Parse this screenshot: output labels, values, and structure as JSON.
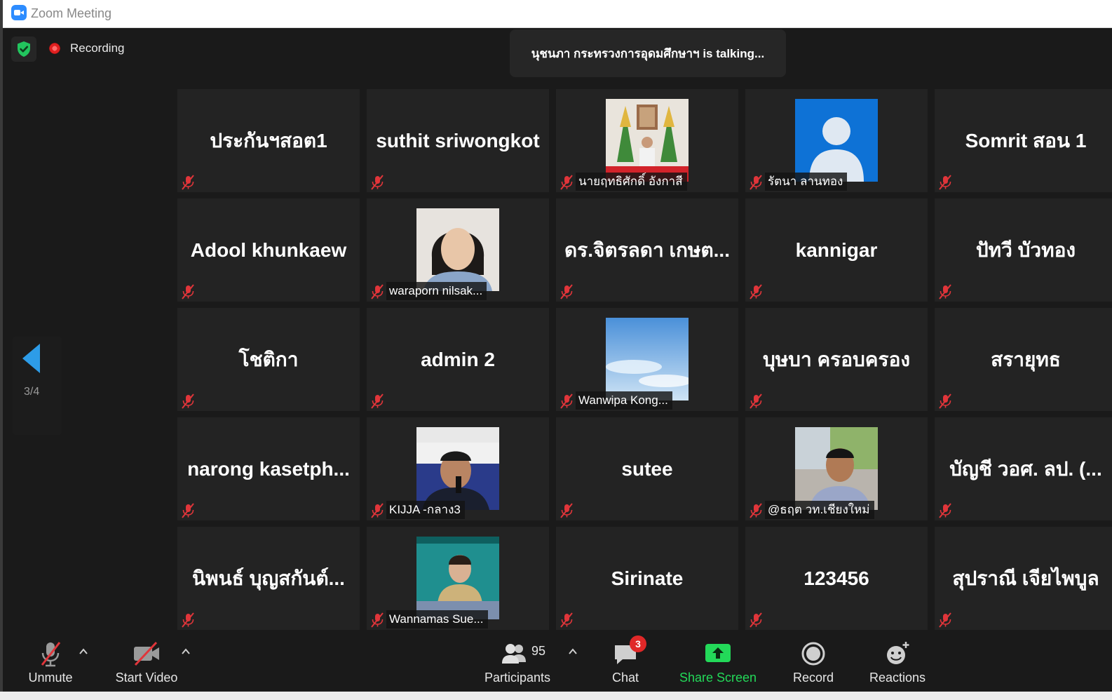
{
  "window": {
    "title": "Zoom Meeting"
  },
  "status": {
    "recording_label": "Recording"
  },
  "talking_banner": "นุชนภา กระทรวงการอุดมศึกษาฯ is talking...",
  "pager": {
    "current": "3/4"
  },
  "participants": [
    {
      "name": "ประกันฯสอต1",
      "video": false,
      "muted": true
    },
    {
      "name": "suthit sriwongkot",
      "video": false,
      "muted": true
    },
    {
      "name": "นายฤทธิศักดิ์ อังกาสี",
      "video": true,
      "photo": "shrine-portrait",
      "muted": true
    },
    {
      "name": "รัตนา ลานทอง",
      "video": true,
      "photo": "default-avatar",
      "muted": true
    },
    {
      "name": "Somrit สอน 1",
      "video": false,
      "muted": true
    },
    {
      "name": "Adool khunkaew",
      "video": false,
      "muted": true
    },
    {
      "name": "waraporn nilsak...",
      "video": true,
      "photo": "woman-portrait",
      "muted": true
    },
    {
      "name": "ดร.จิตรลดา เกษต...",
      "video": false,
      "muted": true
    },
    {
      "name": "kannigar",
      "video": false,
      "muted": true
    },
    {
      "name": "ปัทวี บัวทอง",
      "video": false,
      "muted": true
    },
    {
      "name": "โชติกา",
      "video": false,
      "muted": true
    },
    {
      "name": "admin 2",
      "video": false,
      "muted": true
    },
    {
      "name": "Wanwipa Kong...",
      "video": true,
      "photo": "sky",
      "muted": true
    },
    {
      "name": "บุษบา ครอบครอง",
      "video": false,
      "muted": true
    },
    {
      "name": "สรายุทธ",
      "video": false,
      "muted": true
    },
    {
      "name": "narong kasetph...",
      "video": false,
      "muted": true
    },
    {
      "name": "KIJJA -กลาง3",
      "video": true,
      "photo": "man-microphone",
      "muted": true
    },
    {
      "name": "sutee",
      "video": false,
      "muted": true
    },
    {
      "name": "@ธฤต วท.เชียงใหม่",
      "video": true,
      "photo": "man-outdoor",
      "muted": true
    },
    {
      "name": "บัญชี วอศ. ลป. (...",
      "video": false,
      "muted": true
    },
    {
      "name": "นิพนธ์ บุญสกันต์...",
      "video": false,
      "muted": true
    },
    {
      "name": "Wannamas Sue...",
      "video": true,
      "photo": "woman-desk",
      "muted": true
    },
    {
      "name": "Sirinate",
      "video": false,
      "muted": true
    },
    {
      "name": "123456",
      "video": false,
      "muted": true
    },
    {
      "name": "สุปราณี เจียไพบูล",
      "video": false,
      "muted": true
    }
  ],
  "toolbar": {
    "unmute": "Unmute",
    "start_video": "Start Video",
    "participants": "Participants",
    "participants_count": "95",
    "chat": "Chat",
    "chat_badge": "3",
    "share_screen": "Share Screen",
    "record": "Record",
    "reactions": "Reactions"
  },
  "colors": {
    "share_green": "#23d959",
    "accent_blue": "#2d9ce8",
    "mute_red": "#e0353a",
    "badge_red": "#e02828",
    "shield_green": "#22c55e"
  }
}
